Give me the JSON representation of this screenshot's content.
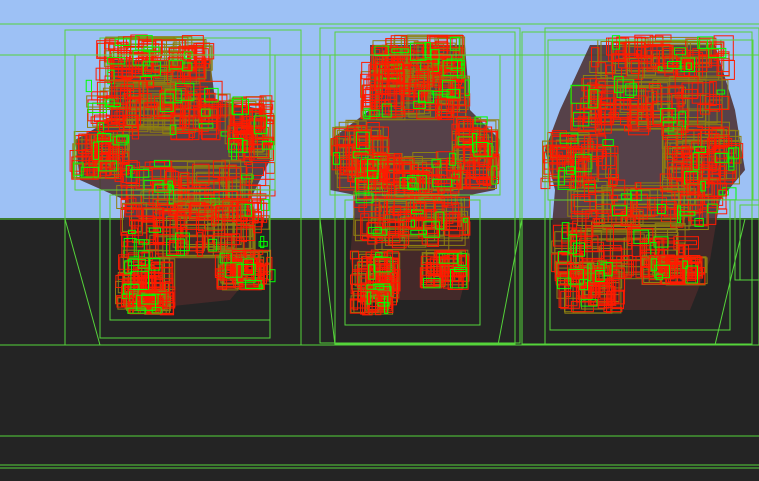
{
  "scene": {
    "sky_color": "#9dc1f5",
    "ground_color": "#242424",
    "outer_box_color": "#55d43a",
    "inner_box_color": "#8e7f10",
    "leaf_box_color": "#ff1a00",
    "highlight_box_color": "#00ff00",
    "floor_line_color": "#55d43a",
    "figure_count": 3
  }
}
